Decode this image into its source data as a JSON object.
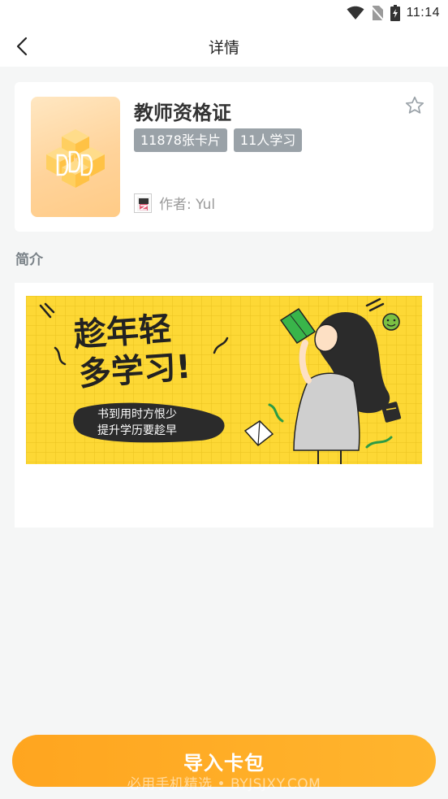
{
  "status_bar": {
    "time": "11:14"
  },
  "nav": {
    "title": "详情"
  },
  "deck": {
    "title": "教师资格证",
    "tags": [
      "11878张卡片",
      "11人学习"
    ],
    "author": "作者: Yul"
  },
  "intro": {
    "section_label": "简介",
    "banner": {
      "headline_line1": "趁年轻",
      "headline_line2": "多学习!",
      "slogan_line1": "书到用时方恨少",
      "slogan_line2": "提升学历要趁早"
    }
  },
  "action": {
    "import_label": "导入卡包"
  },
  "watermark": "必用手机精选 • BYJSJXY.COM",
  "colors": {
    "accent": "#ffab25",
    "tag_bg": "#9aa2a8",
    "banner_bg": "#fdd835",
    "page_bg": "#f5f6f6"
  }
}
